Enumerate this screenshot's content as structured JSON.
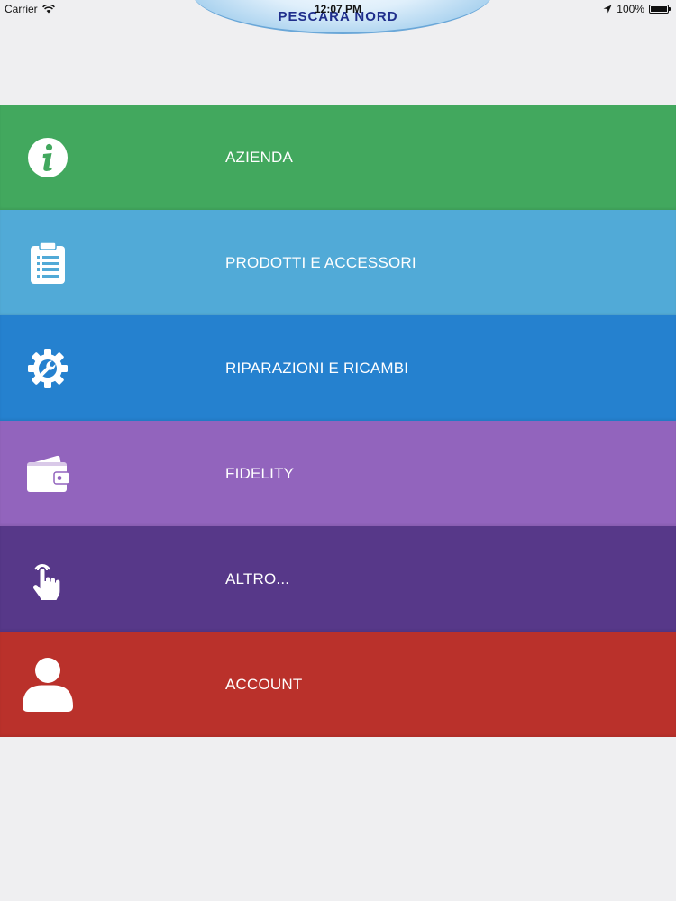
{
  "status_bar": {
    "carrier": "Carrier",
    "time": "12:07 PM",
    "battery": "100%",
    "battery_level": 1.0
  },
  "header": {
    "logo_text": "PESCARA NORD"
  },
  "menu": {
    "items": [
      {
        "label": "AZIENDA",
        "icon": "info-icon",
        "color": "#42a85e"
      },
      {
        "label": "PRODOTTI E ACCESSORI",
        "icon": "clipboard-icon",
        "color": "#51aad7"
      },
      {
        "label": "RIPARAZIONI E RICAMBI",
        "icon": "gear-wrench-icon",
        "color": "#2581cf"
      },
      {
        "label": "FIDELITY",
        "icon": "wallet-icon",
        "color": "#9264bd"
      },
      {
        "label": "ALTRO...",
        "icon": "tap-hand-icon",
        "color": "#573889"
      },
      {
        "label": "ACCOUNT",
        "icon": "user-icon",
        "color": "#ba312b"
      }
    ]
  }
}
